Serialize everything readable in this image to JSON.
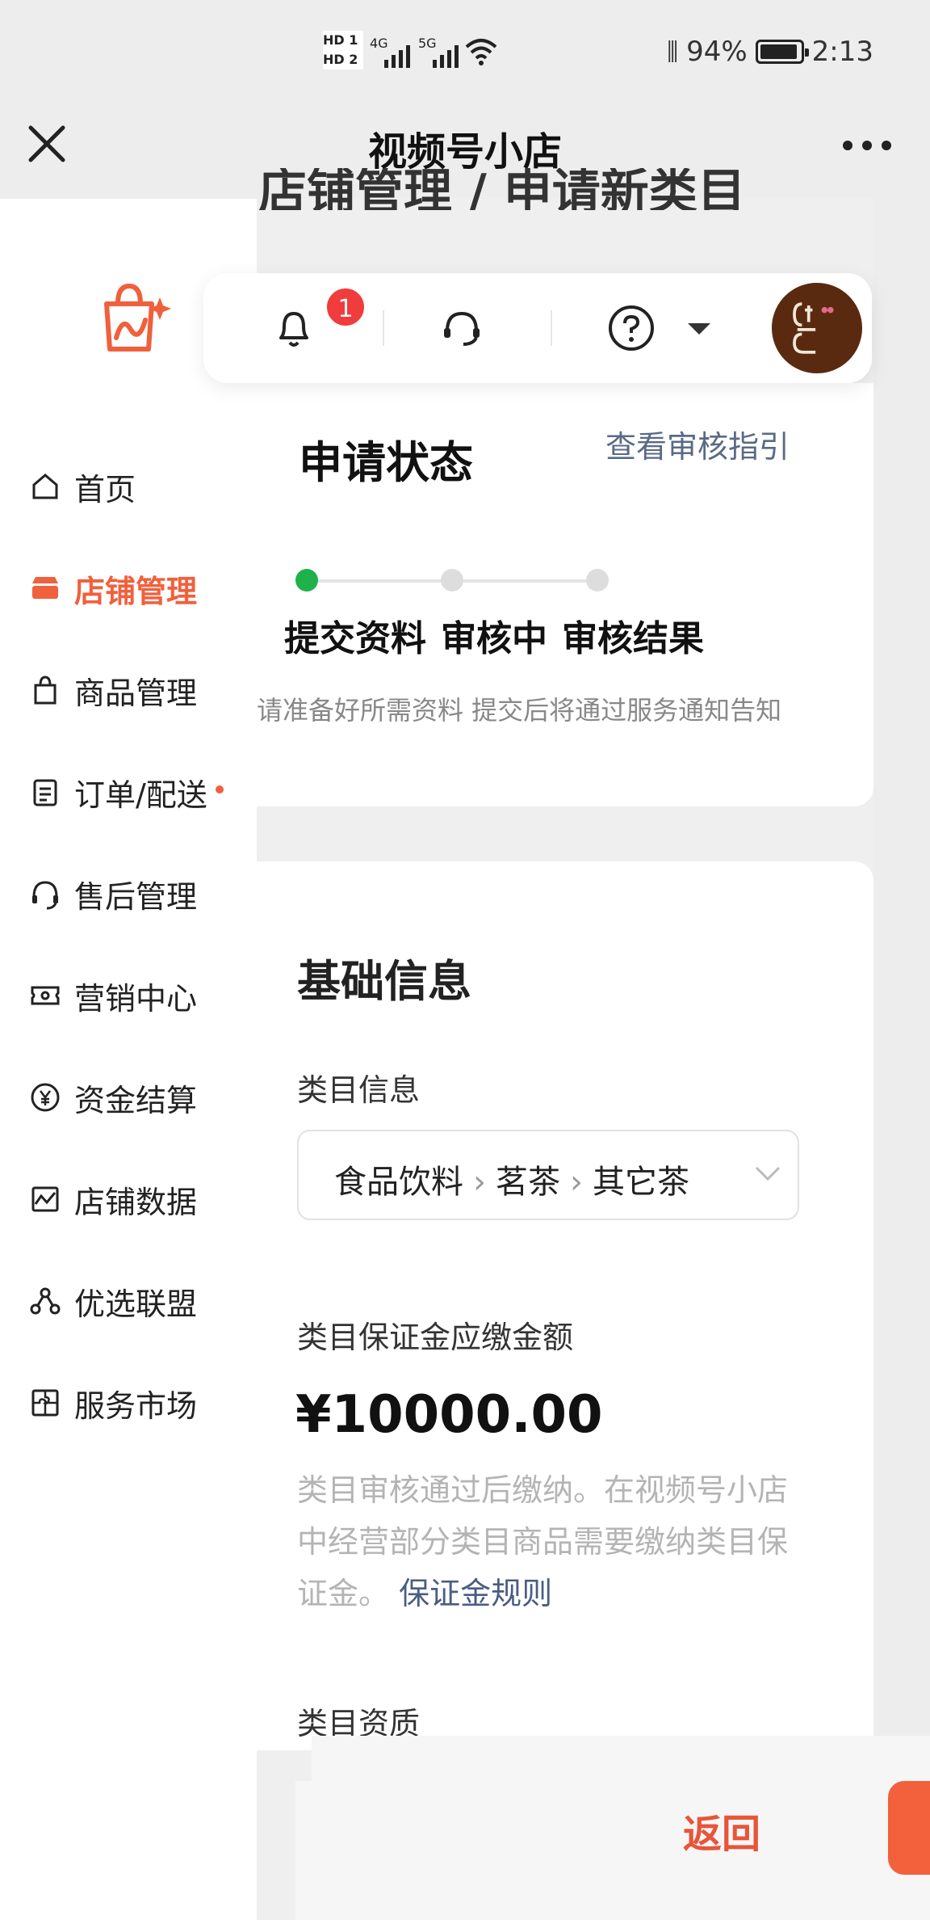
{
  "status_bar": {
    "hd1": "HD 1",
    "hd2": "HD 2",
    "net1": "4G",
    "net2": "5G",
    "battery": "94%",
    "time": "2:13"
  },
  "nav": {
    "title": "视频号小店",
    "close_icon": "close-icon",
    "more_icon": "more-icon"
  },
  "background_title": "店铺管理 / 申请新类目",
  "sidebar": {
    "items": [
      {
        "label": "首页",
        "icon": "home-icon"
      },
      {
        "label": "店铺管理",
        "icon": "store-icon",
        "active": true
      },
      {
        "label": "商品管理",
        "icon": "bag-icon"
      },
      {
        "label": "订单/配送",
        "icon": "order-icon"
      },
      {
        "label": "售后管理",
        "icon": "headset-icon"
      },
      {
        "label": "营销中心",
        "icon": "ticket-icon"
      },
      {
        "label": "资金结算",
        "icon": "yuan-icon"
      },
      {
        "label": "店铺数据",
        "icon": "chart-icon"
      },
      {
        "label": "优选联盟",
        "icon": "alliance-icon"
      },
      {
        "label": "服务市场",
        "icon": "puzzle-icon"
      }
    ]
  },
  "toolbar": {
    "badge": "1",
    "accent": "#f03c3c"
  },
  "status_card": {
    "title": "申请状态",
    "link": "查看审核指引",
    "steps": [
      "提交资料",
      "审核中",
      "审核结果"
    ],
    "hint": "请准备好所需资料 提交后将通过服务通知告知"
  },
  "info_card": {
    "title": "基础信息",
    "category_label": "类目信息",
    "category_path": [
      "食品饮料",
      "茗茶",
      "其它茶"
    ],
    "deposit_label": "类目保证金应缴金额",
    "deposit_amount": "¥10000.00",
    "deposit_desc": "类目审核通过后缴纳。在视频号小店中经营部分类目商品需要缴纳类目保证金。",
    "deposit_link": "保证金规则",
    "qualification_label": "类目资质"
  },
  "bottom": {
    "back_label": "返回"
  },
  "colors": {
    "brand": "#f0603c",
    "success": "#1fb24a",
    "link": "#5a6a86"
  }
}
